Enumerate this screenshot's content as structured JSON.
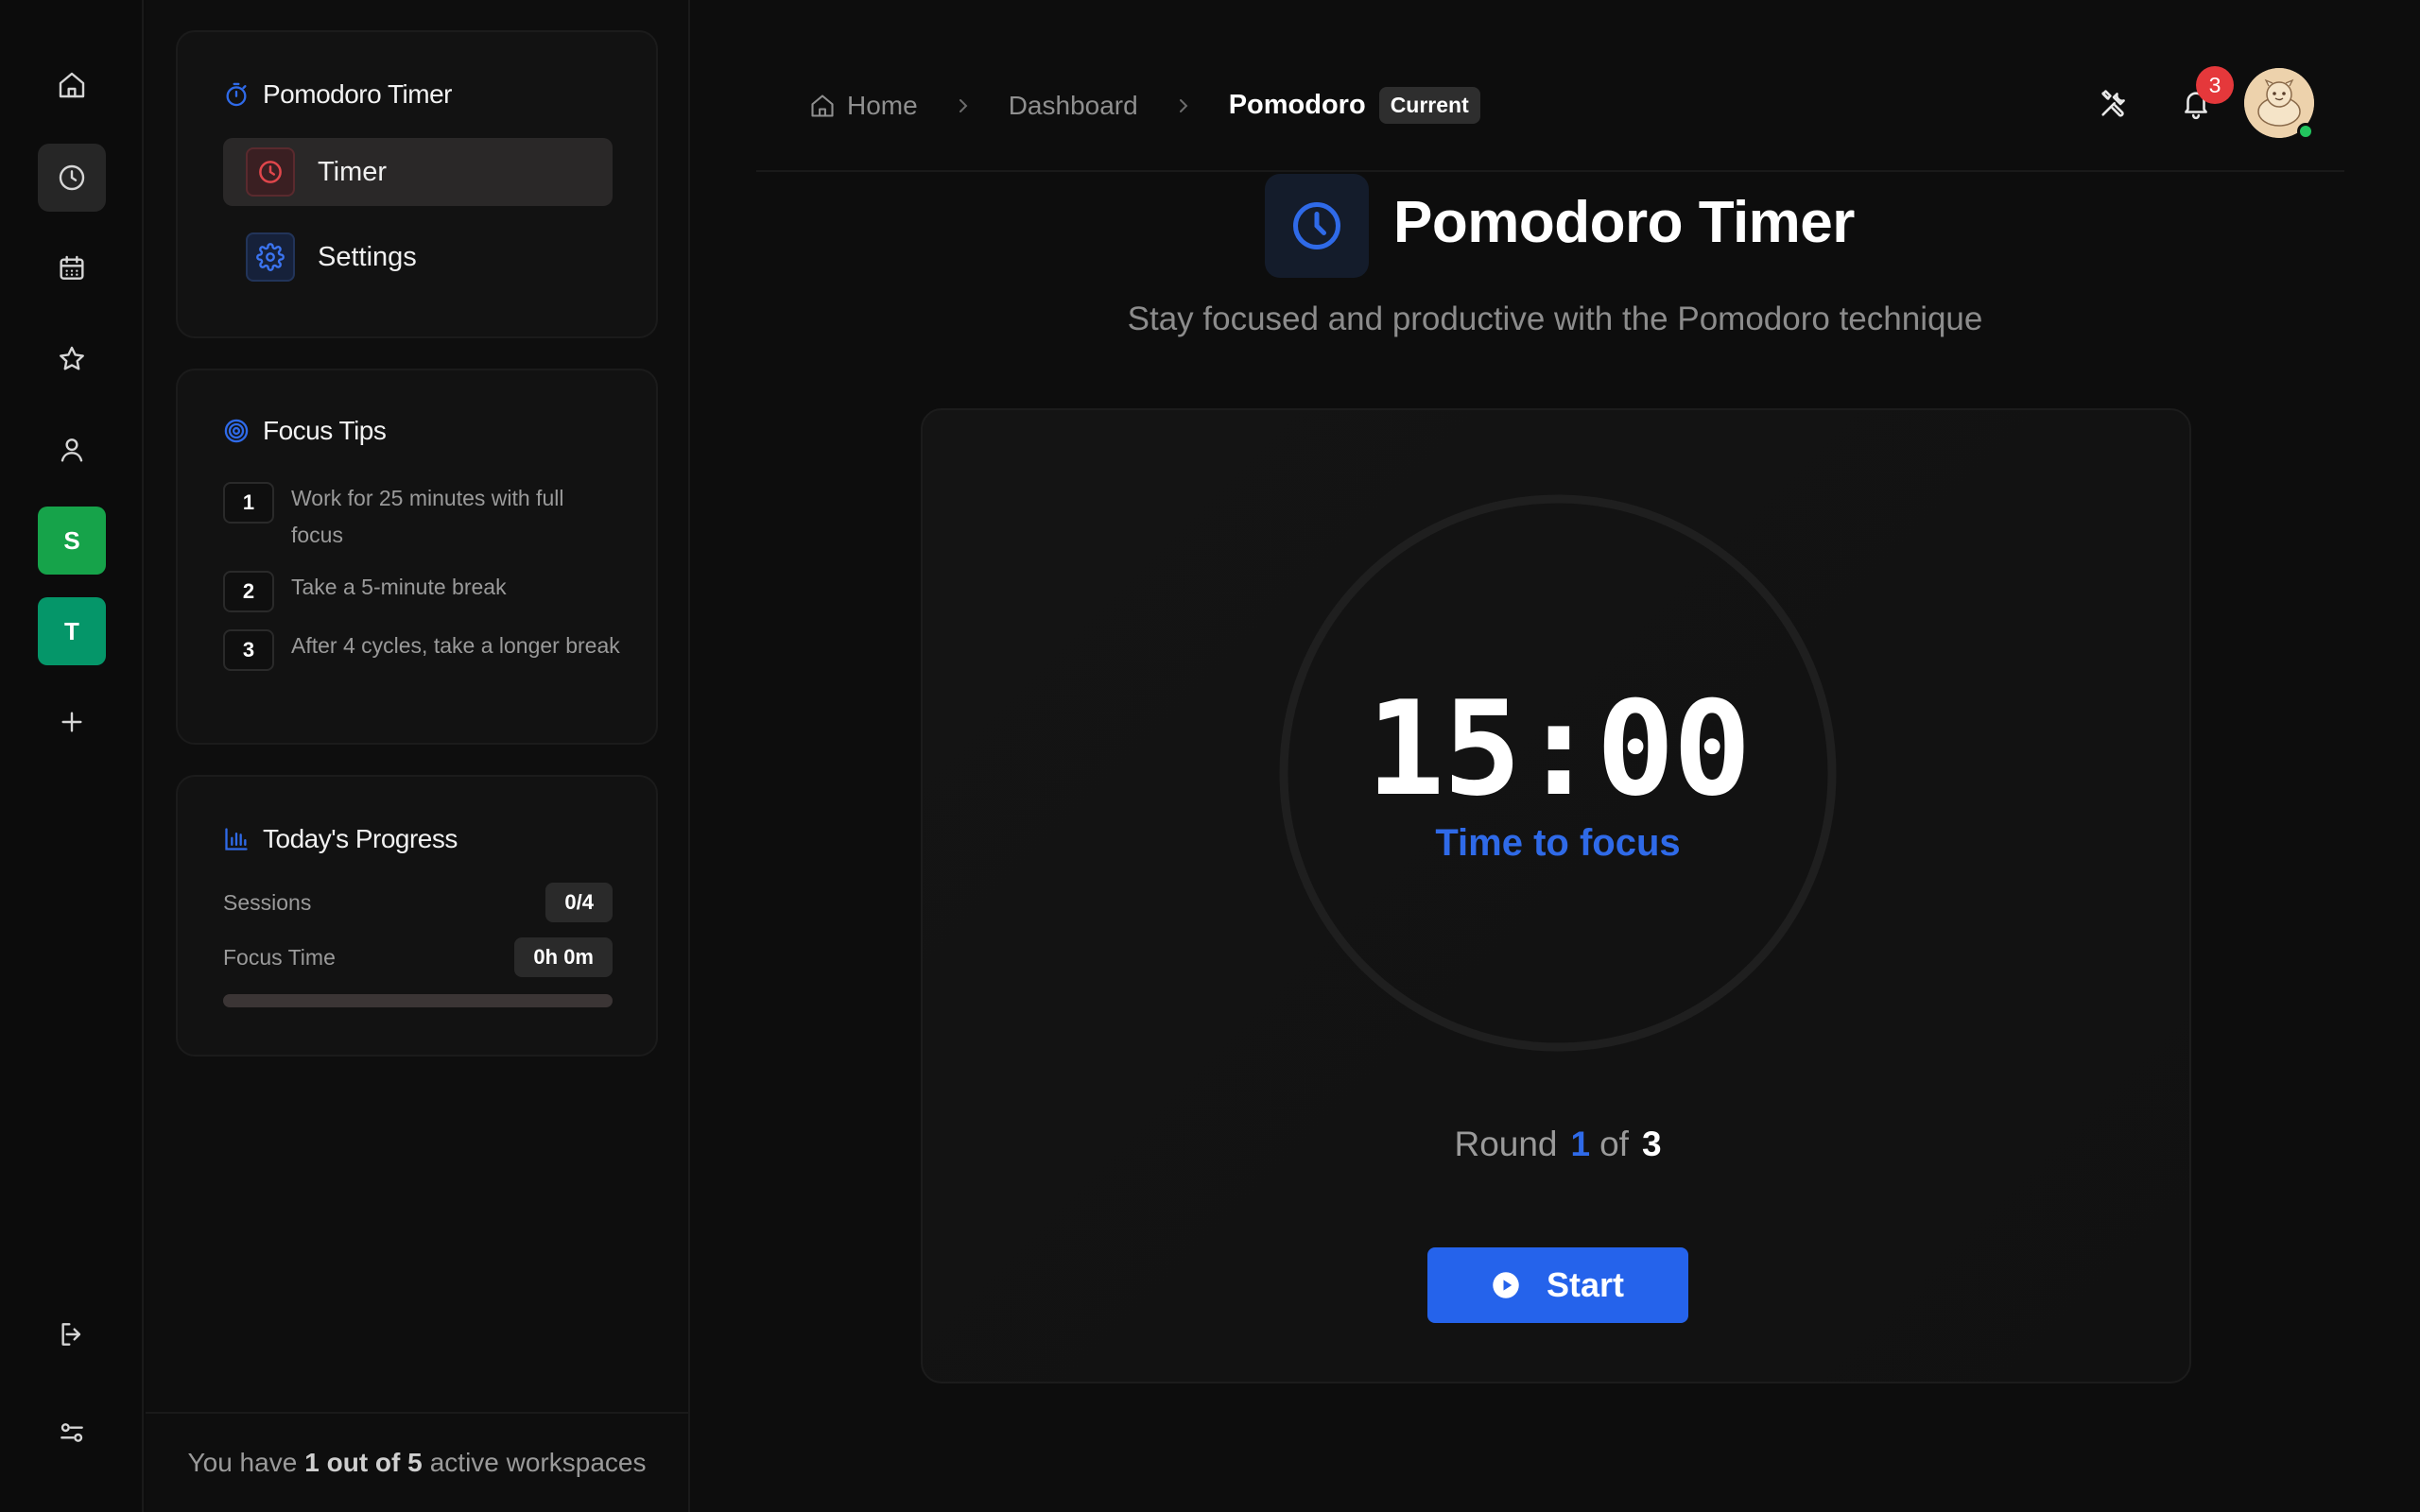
{
  "rail": {
    "items": [
      {
        "name": "home-icon"
      },
      {
        "name": "clock-icon"
      },
      {
        "name": "calendar-icon"
      },
      {
        "name": "star-icon"
      },
      {
        "name": "user-icon"
      }
    ],
    "workspaces": [
      {
        "letter": "S",
        "color": "#16a34a"
      },
      {
        "letter": "T",
        "color": "#059669"
      }
    ]
  },
  "sidebar": {
    "app": {
      "title": "Pomodoro Timer",
      "items": [
        {
          "label": "Timer",
          "icon": "clock-icon",
          "active": true
        },
        {
          "label": "Settings",
          "icon": "gear-icon",
          "active": false
        }
      ]
    },
    "tips": {
      "title": "Focus Tips",
      "items": [
        {
          "num": "1",
          "text": "Work for 25 minutes with full focus"
        },
        {
          "num": "2",
          "text": "Take a 5-minute break"
        },
        {
          "num": "3",
          "text": "After 4 cycles, take a longer break"
        }
      ]
    },
    "progress": {
      "title": "Today's Progress",
      "sessions_label": "Sessions",
      "sessions_value": "0/4",
      "focus_label": "Focus Time",
      "focus_value": "0h 0m",
      "fraction": 0
    },
    "footer": {
      "prefix": "You have",
      "count": "1 out of 5",
      "suffix": "active workspaces"
    }
  },
  "header": {
    "breadcrumb": {
      "home": "Home",
      "dashboard": "Dashboard",
      "current": "Pomodoro",
      "badge": "Current"
    },
    "notifications": "3"
  },
  "main": {
    "title": "Pomodoro Timer",
    "subtitle": "Stay focused and productive with the Pomodoro technique",
    "timer": {
      "time": "15:00",
      "status": "Time to focus",
      "round_label": "Round",
      "round_current": "1",
      "round_of": "of",
      "round_total": "3",
      "start_label": "Start"
    }
  },
  "colors": {
    "accent": "#2563eb",
    "background": "#0d0d0d",
    "panel": "#121212",
    "notification": "#e5383b",
    "online": "#22c55e"
  }
}
